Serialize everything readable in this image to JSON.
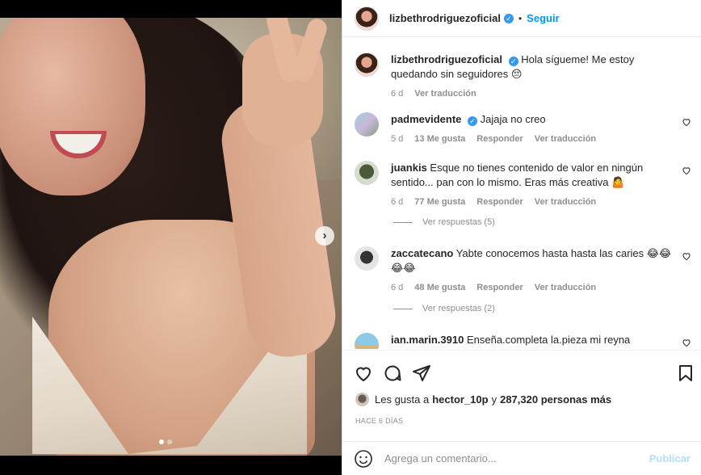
{
  "post": {
    "author": "lizbethrodriguezoficial",
    "follow_label": "Seguir",
    "separator": "•",
    "carousel": {
      "count": 2,
      "active": 1
    }
  },
  "comments": [
    {
      "user": "lizbethrodriguezoficial",
      "text": "Hola sígueme! Me estoy quedando sin seguidores 😔",
      "age": "6 d",
      "translate": "Ver traducción",
      "verified": true
    },
    {
      "user": "padmevidente",
      "text": "Jajaja no creo",
      "age": "5 d",
      "likes": "13 Me gusta",
      "reply": "Responder",
      "translate": "Ver traducción",
      "verified": true
    },
    {
      "user": "juankis",
      "text": "Esque no tienes contenido de valor en ningún sentido... pan con lo mismo. Eras más creativa 🤷",
      "age": "6 d",
      "likes": "77 Me gusta",
      "reply": "Responder",
      "translate": "Ver traducción",
      "replies": "Ver respuestas (5)"
    },
    {
      "user": "zaccatecano",
      "text": "Yabte conocemos hasta hasta las caries 😂😂😂😂",
      "age": "6 d",
      "likes": "48 Me gusta",
      "reply": "Responder",
      "translate": "Ver traducción",
      "replies": "Ver respuestas (2)"
    },
    {
      "user": "ian.marin.3910",
      "text": "Enseña.completa la.pieza mi reyna"
    }
  ],
  "likes_summary": {
    "prefix": "Les gusta a",
    "user": "hector_10p",
    "middle": "y",
    "count": "287,320 personas más"
  },
  "date_label": "HACE 6 DÍAS",
  "composer": {
    "placeholder": "Agrega un comentario...",
    "publish_label": "Publicar"
  },
  "colors": {
    "link": "#0095f6",
    "verified": "#3897f0",
    "muted": "#8e8e8e"
  },
  "icons": [
    "chevron-right-icon",
    "heart-icon",
    "comment-icon",
    "share-icon",
    "bookmark-icon",
    "emoji-icon",
    "verified-icon"
  ]
}
